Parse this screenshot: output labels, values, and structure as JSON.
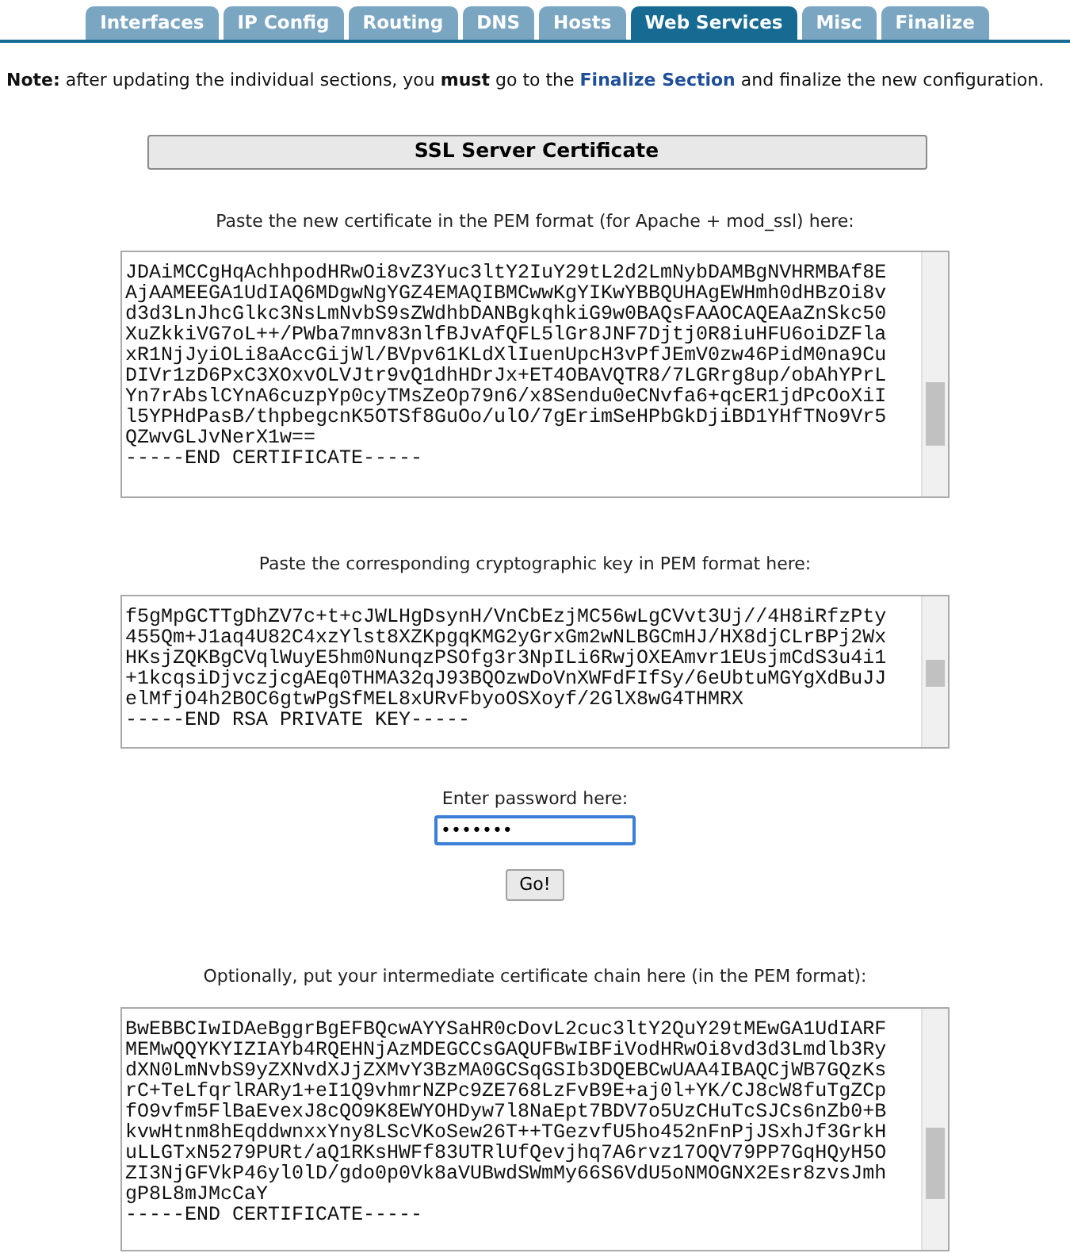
{
  "tabs": [
    {
      "label": "Interfaces",
      "selected": false
    },
    {
      "label": "IP Config",
      "selected": false
    },
    {
      "label": "Routing",
      "selected": false
    },
    {
      "label": "DNS",
      "selected": false
    },
    {
      "label": "Hosts",
      "selected": false
    },
    {
      "label": "Web Services",
      "selected": true
    },
    {
      "label": "Misc",
      "selected": false
    },
    {
      "label": "Finalize",
      "selected": false
    }
  ],
  "note": "**Note:** after updating the individual sections, you **must** go to the ",
  "note_link": "Finalize Section",
  "note_end": " and finalize the new configuration.",
  "section_title": "SSL Server Certificate",
  "certificate": {
    "label": "Paste the new certificate in the PEM format (for Apache + mod_ssl) here:",
    "lines": [
      "JDAiMCCgHqAchhpodHRwOi8vZ3Yuc3ltY2IuY29tL2d2LmNybDAMBgNVHRMBAf8E",
      "AjAAMEEGA1UdIAQ6MDgwNgYGZ4EMAQIBMCwwKgYIKwYBBQUHAgEWHmh0dHBzOi8v",
      "d3d3LnJhcGlkc3NsLmNvbS9sZWdhbDANBgkqhkiG9w0BAQsFAAOCAQEAaZnSkc50",
      "XuZkkiVG7oL++/PWba7mnv83nlfBJvAfQFL5lGr8JNF7Djtj0R8iuHFU6oiDZFla",
      "xR1NjJyiOLi8aAccGijWl/BVpv61KLdXlIuenUpcH3vPfJEmV0zw46PidM0na9Cu",
      "DIVr1zD6PxC3XOxvOLVJtr9vQ1dhHDrJx+ET4OBAVQTR8/7LGRrg8up/obAhYPrL",
      "Yn7rAbslCYnA6cuzpYp0cyTMsZeOp79n6/x8Sendu0eCNvfa6+qcER1jdPcOoXiI",
      "l5YPHdPasB/thpbegcnK5OTSf8GuOo/ulO/7gErimSeHPbGkDjiBD1YHfTNo9Vr5",
      "QZwvGLJvNerX1w==",
      "-----END CERTIFICATE-----"
    ]
  },
  "key": {
    "label": "Paste the corresponding cryptographic key in PEM format here:",
    "lines": [
      "f5gMpGCTTgDhZV7c+t+cJWLHgDsynH/VnCbEzjMC56wLgCVvt3Uj//4H8iRfzPty",
      "455Qm+J1aq4U82C4xzYlst8XZKpgqKMG2yGrxGm2wNLBGCmHJ/HX8djCLrBPj2Wx",
      "HKsjZQKBgCVqlWuyE5hm0NunqzPSOfg3r3NpILi6RwjOXEAmvr1EUsjmCdS3u4i1",
      "+1kcqsiDjvczjcgAEq0THMA32qJ93BQOzwDoVnXWFdFIfSy/6eUbtuMGYgXdBuJJ",
      "elMfjO4h2BOC6gtwPgSfMEL8xURvFbyoOSXoyf/2GlX8wG4THMRX",
      "-----END RSA PRIVATE KEY-----"
    ]
  },
  "password": {
    "label": "Enter password here:",
    "value": "•••••••"
  },
  "go_button": "Go!",
  "chain": {
    "label": "Optionally, put your intermediate certificate chain here (in the PEM format):",
    "lines": [
      "BwEBBCIwIDAeBggrBgEFBQcwAYYSaHR0cDovL2cuc3ltY2QuY29tMEwGA1UdIARF",
      "MEMwQQYKYIZIAYb4RQEHNjAzMDEGCCsGAQUFBwIBFiVodHRwOi8vd3d3Lmdlb3Ry",
      "dXN0LmNvbS9yZXNvdXJjZXMvY3BzMA0GCSqGSIb3DQEBCwUAA4IBAQCjWB7GQzKs",
      "rC+TeLfqrlRARy1+eI1Q9vhmrNZPc9ZE768LzFvB9E+aj0l+YK/CJ8cW8fuTgZCp",
      "fO9vfm5FlBaEvexJ8cQO9K8EWYOHDyw7l8NaEpt7BDV7o5UzCHuTcSJCs6nZb0+B",
      "kvwHtnm8hEqddwnxxYny8LScVKoSew26T++TGezvfU5ho452nFnPjJSxhJf3GrkH",
      "uLLGTxN5279PURt/aQ1RKsHWFf83UTRlUfQevjhq7A6rvz17OQV79PP7GqHQyH5O",
      "ZI3NjGFVkP46yl0lD/gdo0p0Vk8aVUBwdSWmMy66S6VdU5oNMOGNX2Esr8zvsJmh",
      "gP8L8mJMcCaY",
      "-----END CERTIFICATE-----"
    ]
  }
}
